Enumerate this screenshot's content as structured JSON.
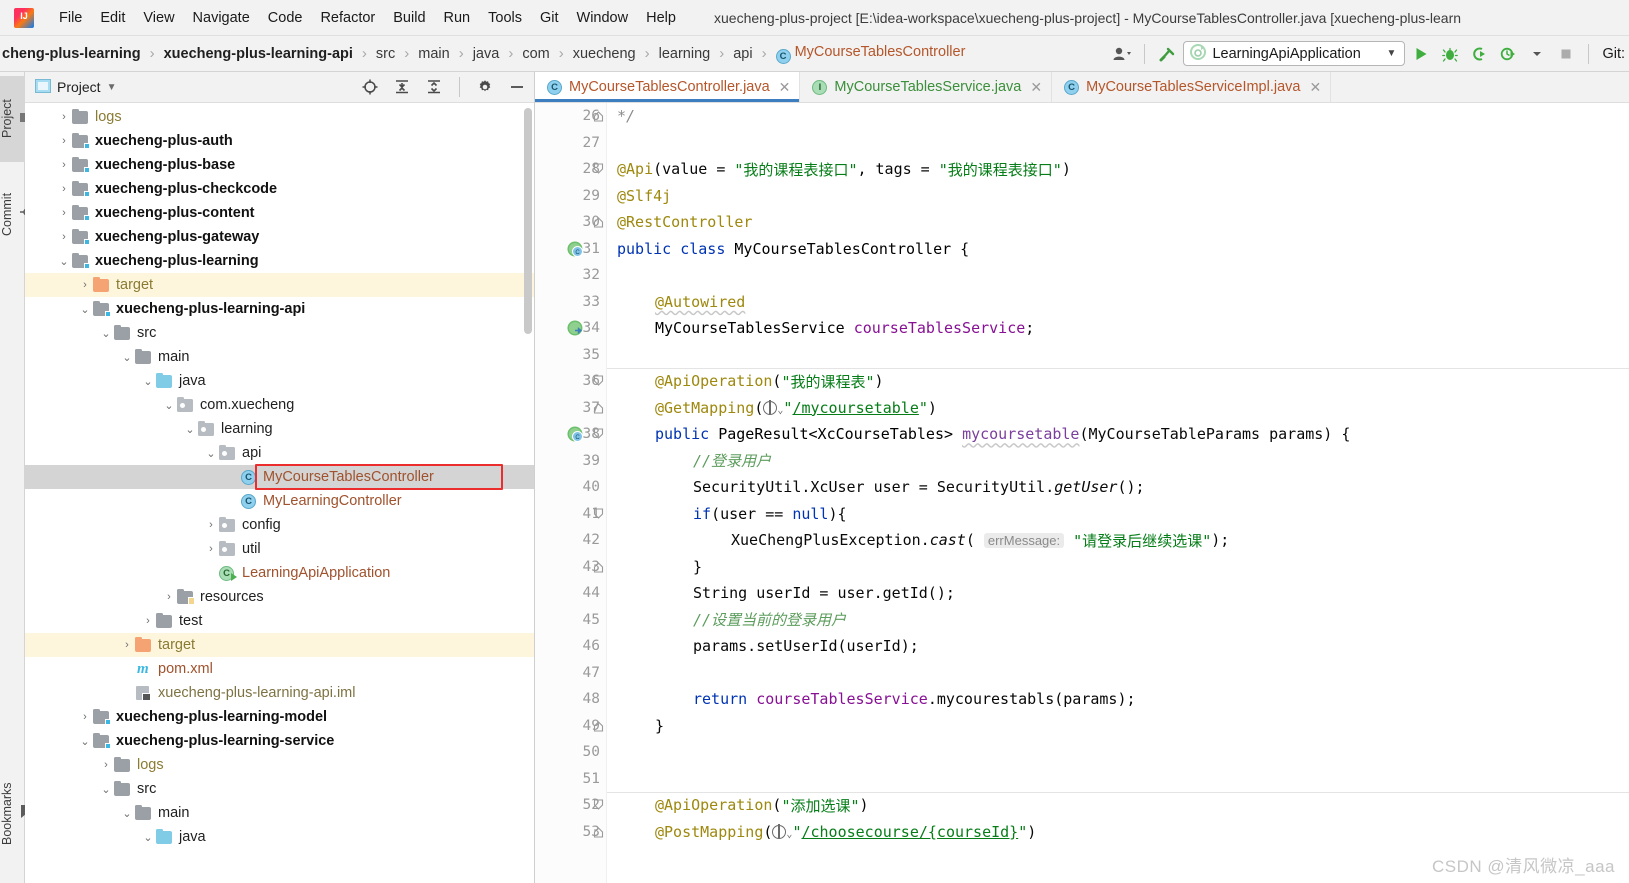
{
  "window": {
    "title": "xuecheng-plus-project [E:\\idea-workspace\\xuecheng-plus-project] - MyCourseTablesController.java [xuecheng-plus-learn"
  },
  "menu": {
    "items": [
      "File",
      "Edit",
      "View",
      "Navigate",
      "Code",
      "Refactor",
      "Build",
      "Run",
      "Tools",
      "Git",
      "Window",
      "Help"
    ]
  },
  "navbar": {
    "crumbs": [
      {
        "label": "cheng-plus-learning",
        "style": "bold"
      },
      {
        "label": "xuecheng-plus-learning-api",
        "style": "bold"
      },
      {
        "label": "src",
        "style": "dim"
      },
      {
        "label": "main",
        "style": "dim"
      },
      {
        "label": "java",
        "style": "dim"
      },
      {
        "label": "com",
        "style": "dim"
      },
      {
        "label": "xuecheng",
        "style": "dim"
      },
      {
        "label": "learning",
        "style": "dim"
      },
      {
        "label": "api",
        "style": "dim"
      },
      {
        "label": "MyCourseTablesController",
        "style": "cls"
      }
    ],
    "run_config": "LearningApiApplication",
    "git_label": "Git:",
    "class_icon_letter": "C"
  },
  "left_strip": {
    "tabs": [
      {
        "label": "Project",
        "icon": "project-icon",
        "active": true
      },
      {
        "label": "Commit",
        "icon": "commit-icon",
        "active": false
      },
      {
        "label": "Bookmarks",
        "icon": "bookmark-icon",
        "active": false
      }
    ]
  },
  "tool_window": {
    "title": "Project",
    "tree": [
      {
        "indent": 1,
        "arrow": "right",
        "icon": "folder-gray",
        "label": "logs",
        "style": "gold"
      },
      {
        "indent": 1,
        "arrow": "right",
        "icon": "module-folder",
        "label": "xuecheng-plus-auth",
        "style": "bold"
      },
      {
        "indent": 1,
        "arrow": "right",
        "icon": "module-folder",
        "label": "xuecheng-plus-base",
        "style": "bold"
      },
      {
        "indent": 1,
        "arrow": "right",
        "icon": "module-folder",
        "label": "xuecheng-plus-checkcode",
        "style": "bold"
      },
      {
        "indent": 1,
        "arrow": "right",
        "icon": "module-folder",
        "label": "xuecheng-plus-content",
        "style": "bold"
      },
      {
        "indent": 1,
        "arrow": "right",
        "icon": "module-folder",
        "label": "xuecheng-plus-gateway",
        "style": "bold"
      },
      {
        "indent": 1,
        "arrow": "down",
        "icon": "module-folder",
        "label": "xuecheng-plus-learning",
        "style": "bold"
      },
      {
        "indent": 2,
        "arrow": "right",
        "icon": "folder-orange",
        "label": "target",
        "style": "gold",
        "highlight": "yellow"
      },
      {
        "indent": 2,
        "arrow": "down",
        "icon": "module-folder",
        "label": "xuecheng-plus-learning-api",
        "style": "bold"
      },
      {
        "indent": 3,
        "arrow": "down",
        "icon": "folder-gray",
        "label": "src",
        "style": "dark"
      },
      {
        "indent": 4,
        "arrow": "down",
        "icon": "folder-gray",
        "label": "main",
        "style": "dark"
      },
      {
        "indent": 5,
        "arrow": "down",
        "icon": "folder-cyan",
        "label": "java",
        "style": "dark"
      },
      {
        "indent": 6,
        "arrow": "down",
        "icon": "package",
        "label": "com.xuecheng",
        "style": "dark"
      },
      {
        "indent": 7,
        "arrow": "down",
        "icon": "package",
        "label": "learning",
        "style": "dark"
      },
      {
        "indent": 8,
        "arrow": "down",
        "icon": "package",
        "label": "api",
        "style": "dark"
      },
      {
        "indent": 9,
        "arrow": "none",
        "icon": "java-class",
        "label": "MyCourseTablesController",
        "style": "brown",
        "highlight": "selected",
        "redbox": true
      },
      {
        "indent": 9,
        "arrow": "none",
        "icon": "java-class",
        "label": "MyLearningController",
        "style": "brown"
      },
      {
        "indent": 8,
        "arrow": "right",
        "icon": "package",
        "label": "config",
        "style": "dark"
      },
      {
        "indent": 8,
        "arrow": "right",
        "icon": "package",
        "label": "util",
        "style": "dark"
      },
      {
        "indent": 8,
        "arrow": "none",
        "icon": "spring-app",
        "label": "LearningApiApplication",
        "style": "brown"
      },
      {
        "indent": 6,
        "arrow": "right",
        "icon": "resources",
        "label": "resources",
        "style": "dark"
      },
      {
        "indent": 5,
        "arrow": "right",
        "icon": "folder-gray",
        "label": "test",
        "style": "dark"
      },
      {
        "indent": 4,
        "arrow": "right",
        "icon": "folder-orange",
        "label": "target",
        "style": "gold",
        "highlight": "yellow"
      },
      {
        "indent": 4,
        "arrow": "none",
        "icon": "maven-pom",
        "label": "pom.xml",
        "style": "brown"
      },
      {
        "indent": 4,
        "arrow": "none",
        "icon": "iml-file",
        "label": "xuecheng-plus-learning-api.iml",
        "style": "olive"
      },
      {
        "indent": 2,
        "arrow": "right",
        "icon": "module-folder",
        "label": "xuecheng-plus-learning-model",
        "style": "bold"
      },
      {
        "indent": 2,
        "arrow": "down",
        "icon": "module-folder",
        "label": "xuecheng-plus-learning-service",
        "style": "bold"
      },
      {
        "indent": 3,
        "arrow": "right",
        "icon": "folder-gray",
        "label": "logs",
        "style": "gold"
      },
      {
        "indent": 3,
        "arrow": "down",
        "icon": "folder-gray",
        "label": "src",
        "style": "dark"
      },
      {
        "indent": 4,
        "arrow": "down",
        "icon": "folder-gray",
        "label": "main",
        "style": "dark"
      },
      {
        "indent": 5,
        "arrow": "down",
        "icon": "folder-cyan",
        "label": "java",
        "style": "dark"
      }
    ]
  },
  "editor": {
    "tabs": [
      {
        "label": "MyCourseTablesController.java",
        "icon": "class-icon",
        "icon_letter": "C",
        "color": "ctl",
        "active": true
      },
      {
        "label": "MyCourseTablesService.java",
        "icon": "interface-icon",
        "icon_letter": "I",
        "color": "svc",
        "active": false
      },
      {
        "label": "MyCourseTablesServiceImpl.java",
        "icon": "class-icon",
        "icon_letter": "C",
        "color": "ctl",
        "active": false
      }
    ],
    "first_line": 26,
    "lines": [
      {
        "n": 26,
        "fold": "end",
        "mark": "",
        "indent": 0,
        "tokens": [
          {
            "t": "cmt",
            "s": "*/"
          }
        ]
      },
      {
        "n": 27,
        "fold": "",
        "mark": "",
        "indent": 0,
        "tokens": []
      },
      {
        "n": 28,
        "fold": "open",
        "mark": "",
        "indent": 0,
        "tokens": [
          {
            "t": "ann",
            "s": "@Api"
          },
          {
            "t": "plain",
            "s": "(value = "
          },
          {
            "t": "str",
            "s": "\"我的课程表接口\""
          },
          {
            "t": "plain",
            "s": ", tags = "
          },
          {
            "t": "str",
            "s": "\"我的课程表接口\""
          },
          {
            "t": "plain",
            "s": ")"
          }
        ]
      },
      {
        "n": 29,
        "fold": "",
        "mark": "",
        "indent": 0,
        "tokens": [
          {
            "t": "ann",
            "s": "@Slf4j"
          }
        ]
      },
      {
        "n": 30,
        "fold": "end",
        "mark": "",
        "indent": 0,
        "tokens": [
          {
            "t": "ann",
            "s": "@RestController"
          }
        ]
      },
      {
        "n": 31,
        "fold": "",
        "mark": "bean",
        "indent": 0,
        "tokens": [
          {
            "t": "kw",
            "s": "public "
          },
          {
            "t": "kw",
            "s": "class "
          },
          {
            "t": "type",
            "s": "MyCourseTablesController"
          },
          {
            "t": "plain",
            "s": " {"
          }
        ]
      },
      {
        "n": 32,
        "fold": "",
        "mark": "",
        "indent": 0,
        "tokens": []
      },
      {
        "n": 33,
        "fold": "",
        "mark": "",
        "indent": 1,
        "tokens": [
          {
            "t": "ann-wavy",
            "s": "@Autowired"
          }
        ]
      },
      {
        "n": 34,
        "fold": "",
        "mark": "autowire",
        "indent": 1,
        "tokens": [
          {
            "t": "type",
            "s": "MyCourseTablesService "
          },
          {
            "t": "fld",
            "s": "courseTablesService"
          },
          {
            "t": "plain",
            "s": ";"
          }
        ]
      },
      {
        "n": 35,
        "fold": "",
        "mark": "",
        "indent": 1,
        "tokens": []
      },
      {
        "n": 36,
        "fold": "open",
        "mark": "",
        "indent": 1,
        "tokens": [
          {
            "t": "ann",
            "s": "@ApiOperation"
          },
          {
            "t": "plain",
            "s": "("
          },
          {
            "t": "str",
            "s": "\"我的课程表\""
          },
          {
            "t": "plain",
            "s": ")"
          }
        ]
      },
      {
        "n": 37,
        "fold": "end",
        "mark": "",
        "indent": 1,
        "tokens": [
          {
            "t": "ann",
            "s": "@GetMapping"
          },
          {
            "t": "plain",
            "s": "("
          },
          {
            "t": "globe",
            "s": ""
          },
          {
            "t": "str",
            "s": "\""
          },
          {
            "t": "url",
            "s": "/mycoursetable"
          },
          {
            "t": "str",
            "s": "\""
          },
          {
            "t": "plain",
            "s": ")"
          }
        ]
      },
      {
        "n": 38,
        "fold": "open",
        "mark": "bean",
        "indent": 1,
        "tokens": [
          {
            "t": "kw",
            "s": "public "
          },
          {
            "t": "type",
            "s": "PageResult<XcCourseTables> "
          },
          {
            "t": "mth-wavy",
            "s": "mycoursetable"
          },
          {
            "t": "plain",
            "s": "(MyCourseTableParams params) {"
          }
        ]
      },
      {
        "n": 39,
        "fold": "",
        "mark": "",
        "indent": 2,
        "tokens": [
          {
            "t": "cmt-cn",
            "s": "//登录用户"
          }
        ]
      },
      {
        "n": 40,
        "fold": "",
        "mark": "",
        "indent": 2,
        "tokens": [
          {
            "t": "plain",
            "s": "SecurityUtil.XcUser user = SecurityUtil."
          },
          {
            "t": "static",
            "s": "getUser"
          },
          {
            "t": "plain",
            "s": "();"
          }
        ]
      },
      {
        "n": 41,
        "fold": "open",
        "mark": "",
        "indent": 2,
        "tokens": [
          {
            "t": "kw",
            "s": "if"
          },
          {
            "t": "plain",
            "s": "(user == "
          },
          {
            "t": "kw",
            "s": "null"
          },
          {
            "t": "plain",
            "s": "){"
          }
        ]
      },
      {
        "n": 42,
        "fold": "",
        "mark": "",
        "indent": 3,
        "tokens": [
          {
            "t": "plain",
            "s": "XueChengPlusException."
          },
          {
            "t": "static",
            "s": "cast"
          },
          {
            "t": "plain",
            "s": "( "
          },
          {
            "t": "hint",
            "s": "errMessage:"
          },
          {
            "t": "plain",
            "s": " "
          },
          {
            "t": "str",
            "s": "\"请登录后继续选课\""
          },
          {
            "t": "plain",
            "s": ");"
          }
        ]
      },
      {
        "n": 43,
        "fold": "end",
        "mark": "",
        "indent": 2,
        "tokens": [
          {
            "t": "plain",
            "s": "}"
          }
        ]
      },
      {
        "n": 44,
        "fold": "",
        "mark": "",
        "indent": 2,
        "tokens": [
          {
            "t": "plain",
            "s": "String userId = user.getId();"
          }
        ]
      },
      {
        "n": 45,
        "fold": "",
        "mark": "",
        "indent": 2,
        "tokens": [
          {
            "t": "cmt-cn",
            "s": "//设置当前的登录用户"
          }
        ]
      },
      {
        "n": 46,
        "fold": "",
        "mark": "",
        "indent": 2,
        "tokens": [
          {
            "t": "plain",
            "s": "params.setUserId(userId);"
          }
        ]
      },
      {
        "n": 47,
        "fold": "",
        "mark": "",
        "indent": 2,
        "tokens": []
      },
      {
        "n": 48,
        "fold": "",
        "mark": "",
        "indent": 2,
        "tokens": [
          {
            "t": "kw",
            "s": "return "
          },
          {
            "t": "fld",
            "s": "courseTablesService"
          },
          {
            "t": "plain",
            "s": ".mycourestabls(params);"
          }
        ]
      },
      {
        "n": 49,
        "fold": "end",
        "mark": "",
        "indent": 1,
        "tokens": [
          {
            "t": "plain",
            "s": "}"
          }
        ]
      },
      {
        "n": 50,
        "fold": "",
        "mark": "",
        "indent": 0,
        "tokens": []
      },
      {
        "n": 51,
        "fold": "",
        "mark": "",
        "indent": 0,
        "tokens": []
      },
      {
        "n": 52,
        "fold": "open",
        "mark": "",
        "indent": 1,
        "tokens": [
          {
            "t": "ann",
            "s": "@ApiOperation"
          },
          {
            "t": "plain",
            "s": "("
          },
          {
            "t": "str",
            "s": "\"添加选课\""
          },
          {
            "t": "plain",
            "s": ")"
          }
        ]
      },
      {
        "n": 53,
        "fold": "end",
        "mark": "",
        "indent": 1,
        "tokens": [
          {
            "t": "ann",
            "s": "@PostMapping"
          },
          {
            "t": "plain",
            "s": "("
          },
          {
            "t": "globe",
            "s": ""
          },
          {
            "t": "str",
            "s": "\""
          },
          {
            "t": "url",
            "s": "/choosecourse/{courseId}"
          },
          {
            "t": "str",
            "s": "\""
          },
          {
            "t": "plain",
            "s": ")"
          }
        ]
      }
    ]
  },
  "watermark": "CSDN @清风微凉_aaa",
  "colors": {
    "accent": "#3d7ec0",
    "redbox": "#ec2d2d",
    "highlight_yellow": "#fdf6dd",
    "selection_gray": "#d4d4d4",
    "annotation": "#9e880d",
    "keyword": "#0033b3",
    "string": "#067d17",
    "field": "#871094"
  }
}
